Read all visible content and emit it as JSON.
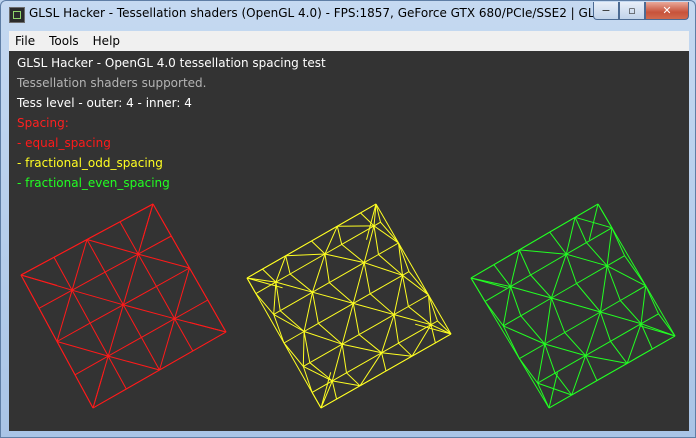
{
  "window": {
    "title": "GLSL Hacker - Tessellation shaders (OpenGL 4.0) - FPS:1857, GeForce GTX 680/PCIe/SSE2 | GLSL Hacke...",
    "buttons": {
      "minimize": "−",
      "maximize": "▫",
      "close": "✕"
    }
  },
  "menu": [
    "File",
    "Tools",
    "Help"
  ],
  "hud": {
    "heading": "GLSL Hacker - OpenGL 4.0 tessellation spacing test",
    "support": "Tessellation shaders supported.",
    "levels": "Tess level - outer: 4 - inner: 4",
    "spacing_label": "Spacing:",
    "modes": [
      "- equal_spacing",
      "- fractional_odd_spacing",
      "- fractional_even_spacing"
    ]
  },
  "colors": {
    "background": "#333333",
    "heading": "#ffffff",
    "support": "#b4b4b4",
    "spacing_label": "#ff2020",
    "equal": "#ff1a1a",
    "odd": "#ffff22",
    "even": "#22ff22"
  },
  "meshes": [
    {
      "name": "equal_spacing",
      "color_key": "equal"
    },
    {
      "name": "fractional_odd_spacing",
      "color_key": "odd"
    },
    {
      "name": "fractional_even_spacing",
      "color_key": "even"
    }
  ]
}
